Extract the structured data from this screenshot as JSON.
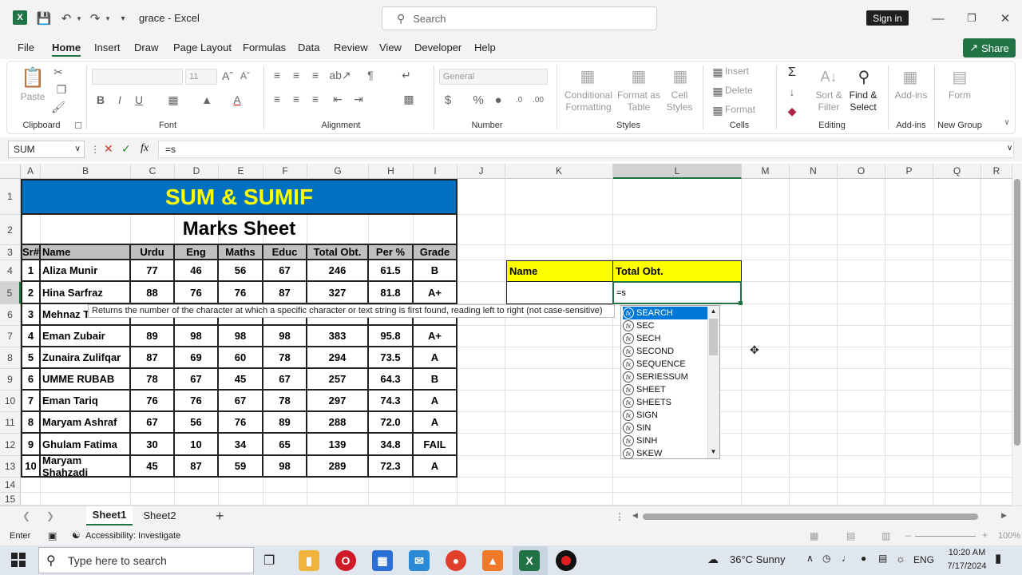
{
  "window": {
    "title": "grace  -  Excel",
    "search_placeholder": "Search",
    "sign_in": "Sign in"
  },
  "menu": {
    "tabs": [
      "File",
      "Home",
      "Insert",
      "Draw",
      "Page Layout",
      "Formulas",
      "Data",
      "Review",
      "View",
      "Developer",
      "Help"
    ],
    "share": "Share"
  },
  "ribbon": {
    "paste": "Paste",
    "clipboard": "Clipboard",
    "font": "Font",
    "font_size": "11",
    "alignment": "Alignment",
    "number_format": "General",
    "number": "Number",
    "conditional_formatting": "Conditional Formatting",
    "format_as_table": "Format as Table",
    "cell_styles": "Cell Styles",
    "styles": "Styles",
    "insert": "Insert",
    "delete": "Delete",
    "format": "Format",
    "cells": "Cells",
    "sort_filter": "Sort & Filter",
    "find_select": "Find & Select",
    "editing": "Editing",
    "add_ins": "Add-ins",
    "add_ins_group": "Add-ins",
    "form": "Form",
    "new_group": "New Group",
    "bold": "B",
    "italic": "I",
    "underline": "U"
  },
  "formula_bar": {
    "name_box": "SUM",
    "formula": "=s",
    "fx": "fx"
  },
  "columns": [
    "A",
    "B",
    "C",
    "D",
    "E",
    "F",
    "G",
    "H",
    "I",
    "J",
    "K",
    "L",
    "M",
    "N",
    "O",
    "P",
    "Q",
    "R"
  ],
  "rows": [
    "1",
    "2",
    "3",
    "4",
    "5",
    "6",
    "7",
    "8",
    "9",
    "10",
    "11",
    "12",
    "13",
    "14",
    "15"
  ],
  "sheet": {
    "title": "SUM & SUMIF",
    "subtitle": "Marks Sheet",
    "headers": [
      "Sr#",
      "Name",
      "Urdu",
      "Eng",
      "Maths",
      "Educ",
      "Total Obt.",
      "Per %",
      "Grade"
    ],
    "records": [
      [
        "1",
        "Aliza Munir",
        "77",
        "46",
        "56",
        "67",
        "246",
        "61.5",
        "B"
      ],
      [
        "2",
        "Hina Sarfraz",
        "88",
        "76",
        "76",
        "87",
        "327",
        "81.8",
        "A+"
      ],
      [
        "3",
        "Mehnaz T",
        "",
        "",
        "",
        "",
        "",
        "",
        ""
      ],
      [
        "4",
        "Eman Zubair",
        "89",
        "98",
        "98",
        "98",
        "383",
        "95.8",
        "A+"
      ],
      [
        "5",
        "Zunaira Zulifqar",
        "87",
        "69",
        "60",
        "78",
        "294",
        "73.5",
        "A"
      ],
      [
        "6",
        "UMME RUBAB",
        "78",
        "67",
        "45",
        "67",
        "257",
        "64.3",
        "B"
      ],
      [
        "7",
        "Eman Tariq",
        "76",
        "76",
        "67",
        "78",
        "297",
        "74.3",
        "A"
      ],
      [
        "8",
        "Maryam Ashraf",
        "67",
        "56",
        "76",
        "89",
        "288",
        "72.0",
        "A"
      ],
      [
        "9",
        "Ghulam Fatima",
        "30",
        "10",
        "34",
        "65",
        "139",
        "34.8",
        "FAIL"
      ],
      [
        "10",
        "Maryam Shahzadi",
        "45",
        "87",
        "59",
        "98",
        "289",
        "72.3",
        "A"
      ]
    ],
    "lookup_name": "Name",
    "lookup_total": "Total Obt.",
    "active_cell_value": "=s"
  },
  "tooltip": "Returns the number of the character at which a specific character or text string is first found, reading left to right (not case-sensitive)",
  "autocomplete": [
    "SEARCH",
    "SEC",
    "SECH",
    "SECOND",
    "SEQUENCE",
    "SERIESSUM",
    "SHEET",
    "SHEETS",
    "SIGN",
    "SIN",
    "SINH",
    "SKEW"
  ],
  "sheet_tabs": [
    "Sheet1",
    "Sheet2"
  ],
  "status": {
    "mode": "Enter",
    "accessibility": "Accessibility: Investigate",
    "zoom": "100%"
  },
  "taskbar": {
    "search": "Type here to search",
    "weather": "36°C  Sunny",
    "lang": "ENG",
    "time": "10:20 AM",
    "date": "7/17/2024"
  },
  "colors": {
    "title_bg": "#0070c0",
    "title_fg": "#ffff00",
    "header_bg": "#c0c0c0",
    "lookup_bg": "#ffff00",
    "accent": "#217346"
  }
}
